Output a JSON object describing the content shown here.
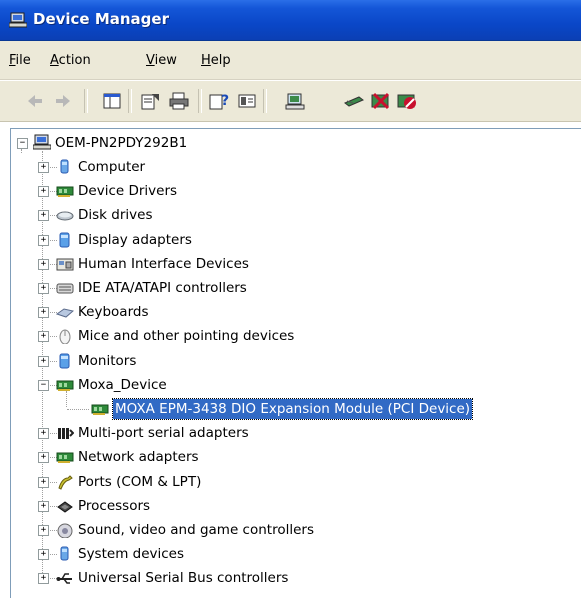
{
  "window": {
    "title": "Device Manager"
  },
  "menu": [
    {
      "pre": "",
      "accel": "F",
      "post": "ile"
    },
    {
      "pre": "",
      "accel": "A",
      "post": "ction"
    },
    {
      "pre": "",
      "accel": "V",
      "post": "iew"
    },
    {
      "pre": "",
      "accel": "H",
      "post": "elp"
    }
  ],
  "toolbar": {
    "buttons": [
      "back-arrow-icon",
      "forward-arrow-icon",
      "console-tree-icon",
      "properties-icon",
      "print-icon",
      "help-icon",
      "view-icon",
      "scan-hardware-icon",
      "update-driver-icon",
      "uninstall-icon",
      "disable-icon"
    ]
  },
  "tree": {
    "root": "OEM-PN2PDY292B1",
    "items": [
      {
        "label": "Computer",
        "icon": "computer-icon"
      },
      {
        "label": "Device Drivers",
        "icon": "card-icon"
      },
      {
        "label": "Disk drives",
        "icon": "disk-icon"
      },
      {
        "label": "Display adapters",
        "icon": "display-icon"
      },
      {
        "label": "Human Interface Devices",
        "icon": "hid-icon"
      },
      {
        "label": "IDE ATA/ATAPI controllers",
        "icon": "ide-icon"
      },
      {
        "label": "Keyboards",
        "icon": "keyboard-icon"
      },
      {
        "label": "Mice and other pointing devices",
        "icon": "mouse-icon"
      },
      {
        "label": "Monitors",
        "icon": "monitor-icon"
      },
      {
        "label": "Moxa_Device",
        "icon": "card-icon",
        "expanded": true
      },
      {
        "label": "MOXA EPM-3438 DIO Expansion Module (PCI Device)",
        "icon": "card-icon",
        "child": true,
        "selected": true
      },
      {
        "label": "Multi-port serial adapters",
        "icon": "serial-icon"
      },
      {
        "label": "Network adapters",
        "icon": "card-icon"
      },
      {
        "label": "Ports (COM & LPT)",
        "icon": "port-icon"
      },
      {
        "label": "Processors",
        "icon": "processor-icon"
      },
      {
        "label": "Sound, video and game controllers",
        "icon": "sound-icon"
      },
      {
        "label": "System devices",
        "icon": "computer-icon"
      },
      {
        "label": "Universal Serial Bus controllers",
        "icon": "usb-icon"
      }
    ]
  }
}
